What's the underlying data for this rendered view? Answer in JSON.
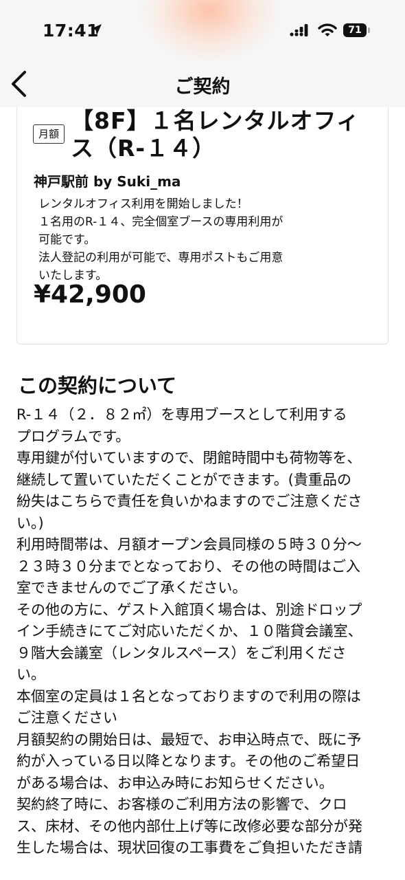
{
  "status_bar": {
    "time": "17:41",
    "battery": "71",
    "icons": [
      "location-arrow-icon",
      "cellular-signal-icon",
      "wifi-icon",
      "battery-icon"
    ]
  },
  "nav": {
    "title": "ご契約",
    "back_icon": "chevron-left-icon"
  },
  "plan": {
    "badge": "月額",
    "title": "【8F】１名レンタルオフィス（R-１４）",
    "location": "神戸駅前 by Suki_ma",
    "description": "レンタルオフィス利用を開始しました！\n１名用のR-１４、完全個室ブースの専用利用が\n可能です。\n法人登記の利用が可能で、専用ポストもご用意\nいたします。",
    "price": "¥42,900"
  },
  "about": {
    "heading": "この契約について",
    "body": "R-１４（２．８２㎡）を専用ブースとして利用する\nプログラムです。\n専用鍵が付いていますので、閉館時間中も荷物等を、\n継続して置いていただくことができます。(貴重品の\n紛失はこちらで責任を負いかねますのでご注意くださ\nい。)\n利用時間帯は、月額オープン会員同様の５時３０分〜\n２３時３０分までとなっており、その他の時間はご入\n室できませんのでご了承ください。\nその他の方に、ゲスト入館頂く場合は、別途ドロップ\nイン手続きにてご対応いただくか、１０階貸会議室、\n９階大会議室（レンタルスペース）をご利用くださ\nい。\n本個室の定員は１名となっておりますので利用の際は\nご注意ください\n月額契約の開始日は、最短で、お申込時点で、既に予\n約が入っている日以降となります。その他のご希望日\nがある場合は、お申込み時にお知らせください。\n契約終了時に、お客様のご利用方法の影響で、クロ\nス、床材、その他内部仕上げ等に改修必要な部分が発\n生した場合は、現状回復の工事費をご負担いただき請"
  }
}
